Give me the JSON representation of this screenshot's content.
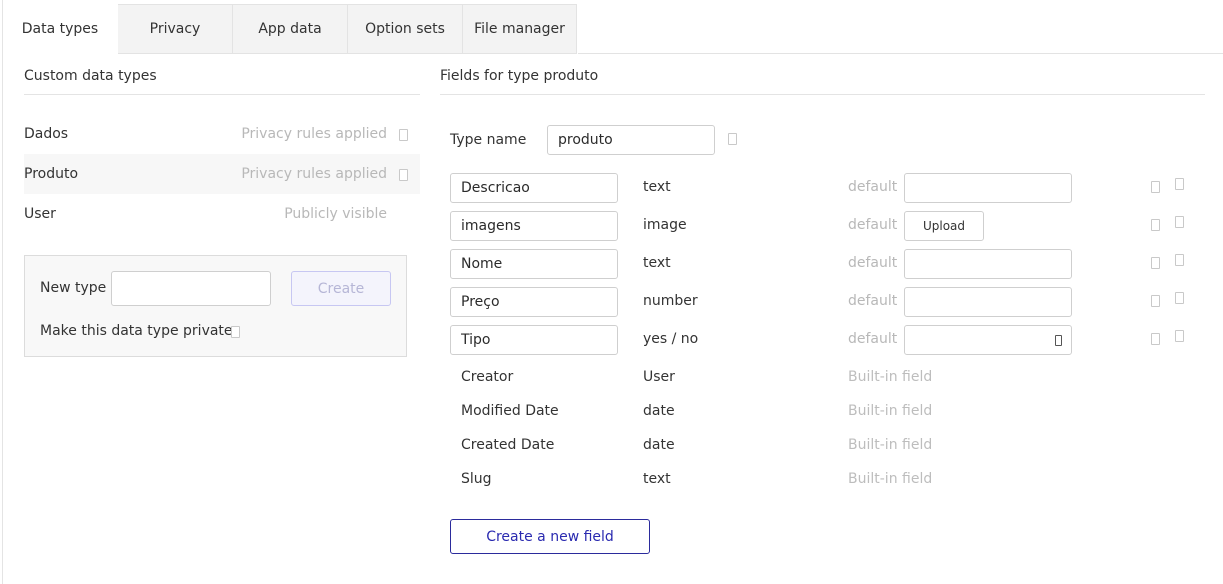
{
  "tabs": [
    {
      "label": "Data types",
      "active": true
    },
    {
      "label": "Privacy",
      "active": false
    },
    {
      "label": "App data",
      "active": false
    },
    {
      "label": "Option sets",
      "active": false
    },
    {
      "label": "File manager",
      "active": false
    }
  ],
  "left": {
    "title": "Custom data types",
    "types": [
      {
        "name": "Dados",
        "status": "Privacy rules applied"
      },
      {
        "name": "Produto",
        "status": "Privacy rules applied"
      },
      {
        "name": "User",
        "status": "Publicly visible"
      }
    ],
    "new_type": {
      "label": "New type",
      "value": "",
      "create_label": "Create",
      "private_label": "Make this data type private"
    }
  },
  "right": {
    "title": "Fields for type produto",
    "type_name_label": "Type name",
    "type_name_value": "produto",
    "default_label": "default",
    "upload_label": "Upload",
    "fields": [
      {
        "name": "Descricao",
        "type": "text",
        "default": ""
      },
      {
        "name": "imagens",
        "type": "image",
        "default": ""
      },
      {
        "name": "Nome",
        "type": "text",
        "default": ""
      },
      {
        "name": "Preço",
        "type": "number",
        "default": ""
      },
      {
        "name": "Tipo",
        "type": "yes / no",
        "default": ""
      }
    ],
    "builtin_label": "Built-in field",
    "builtin_fields": [
      {
        "name": "Creator",
        "type": "User"
      },
      {
        "name": "Modified Date",
        "type": "date"
      },
      {
        "name": "Created Date",
        "type": "date"
      },
      {
        "name": "Slug",
        "type": "text"
      }
    ],
    "create_field_label": "Create a new field"
  },
  "colors": {
    "accent": "#2b2b9c",
    "muted": "#b8b8b8"
  }
}
